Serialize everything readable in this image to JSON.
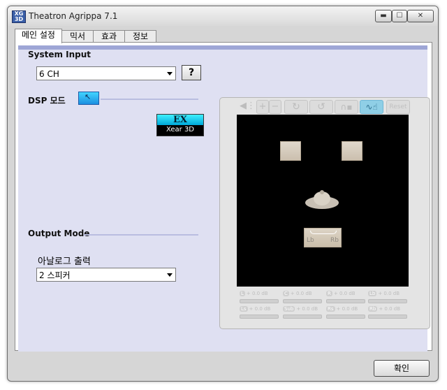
{
  "window": {
    "title": "Theatron Agrippa 7.1",
    "app_icon_text": "XG 3D",
    "controls": [
      "minimize-icon",
      "maximize-icon",
      "close-icon"
    ]
  },
  "tabs": [
    {
      "label": "메인 설정",
      "active": true
    },
    {
      "label": "믹서",
      "active": false
    },
    {
      "label": "효과",
      "active": false
    },
    {
      "label": "정보",
      "active": false
    }
  ],
  "system_input": {
    "heading": "System Input",
    "selected": "6 CH",
    "help_label": "?"
  },
  "dsp": {
    "label": "DSP 모드",
    "badge_top": "EX",
    "badge_bottom": "Xear 3D"
  },
  "viewer": {
    "toolbar": [
      "speaker-mute-icon",
      "zoom-in-icon",
      "zoom-out-icon",
      "rotate-right-icon",
      "rotate-left-icon",
      "headphone-icon",
      "wave-hand-icon"
    ],
    "reset_label": "Reset",
    "rear_labels": {
      "left": "Lb",
      "right": "Rb"
    },
    "channels": [
      {
        "tag": "L",
        "value": "+ 0.0 dB"
      },
      {
        "tag": "C",
        "value": "+ 0.0 dB"
      },
      {
        "tag": "R",
        "value": "+ 0.0 dB"
      },
      {
        "tag": "Lb",
        "value": "+ 0.0 dB"
      },
      {
        "tag": "Ls",
        "value": "+ 0.0 dB"
      },
      {
        "tag": "Sub",
        "value": "+ 0.0 dB"
      },
      {
        "tag": "Rs",
        "value": "+ 0.0 dB"
      },
      {
        "tag": "Rb",
        "value": "+ 0.0 dB"
      }
    ]
  },
  "output": {
    "heading": "Output Mode",
    "analog_label": "아날로그 출력",
    "selected": "2 스피커"
  },
  "footer": {
    "ok_label": "확인"
  }
}
